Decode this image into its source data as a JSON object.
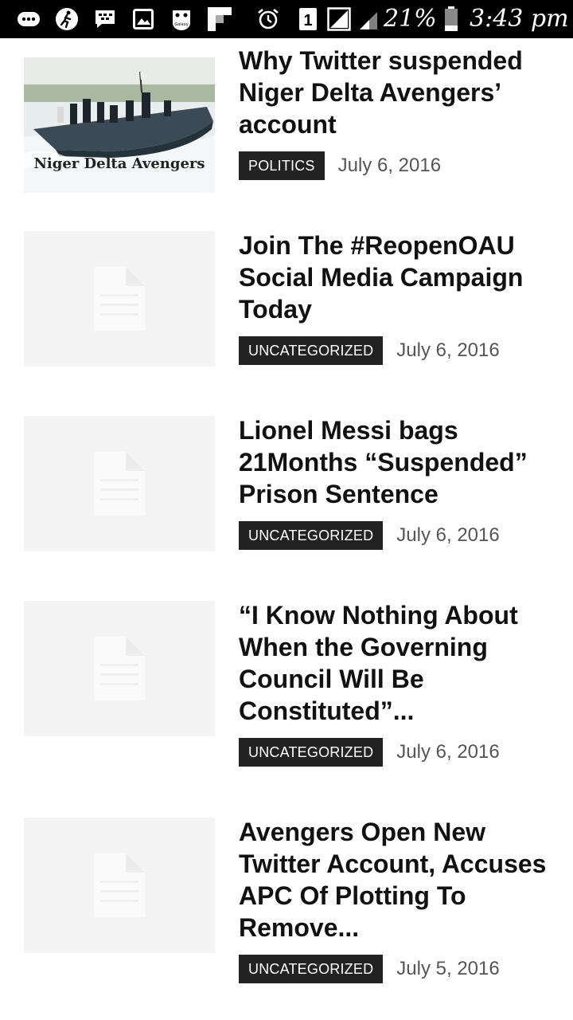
{
  "status_bar": {
    "battery_percent": "21%",
    "sim_slot": "1",
    "time": "3:43 pm",
    "icons": [
      "more-icon",
      "runner-icon",
      "bbm-icon",
      "gallery-icon",
      "galaxy-icon",
      "flipboard-icon",
      "alarm-icon",
      "sim-icon",
      "signal-icon",
      "battery-icon"
    ],
    "galaxy_logo_text": "Galaxy"
  },
  "articles": [
    {
      "title": "Why Twitter suspended Niger Delta Avengers’ account",
      "category": "POLITICS",
      "date": "July 6, 2016",
      "thumbnail": "photo",
      "thumbnail_caption": "Niger Delta Avengers"
    },
    {
      "title": "Join The #ReopenOAU Social Media Campaign Today",
      "category": "UNCATEGORIZED",
      "date": "July 6, 2016",
      "thumbnail": "placeholder"
    },
    {
      "title": "Lionel Messi bags 21Months “Suspended” Prison Sentence",
      "category": "UNCATEGORIZED",
      "date": "July 6, 2016",
      "thumbnail": "placeholder"
    },
    {
      "title": "“I Know Nothing About When the Governing Council Will Be Constituted”...",
      "category": "UNCATEGORIZED",
      "date": "July 6, 2016",
      "thumbnail": "placeholder"
    },
    {
      "title": "Avengers Open New Twitter Account, Accuses APC Of Plotting To Remove...",
      "category": "UNCATEGORIZED",
      "date": "July 5, 2016",
      "thumbnail": "placeholder"
    }
  ],
  "colors": {
    "category_badge": "#222222",
    "placeholder_bg": "#f4f4f4",
    "date_text": "#555555"
  }
}
